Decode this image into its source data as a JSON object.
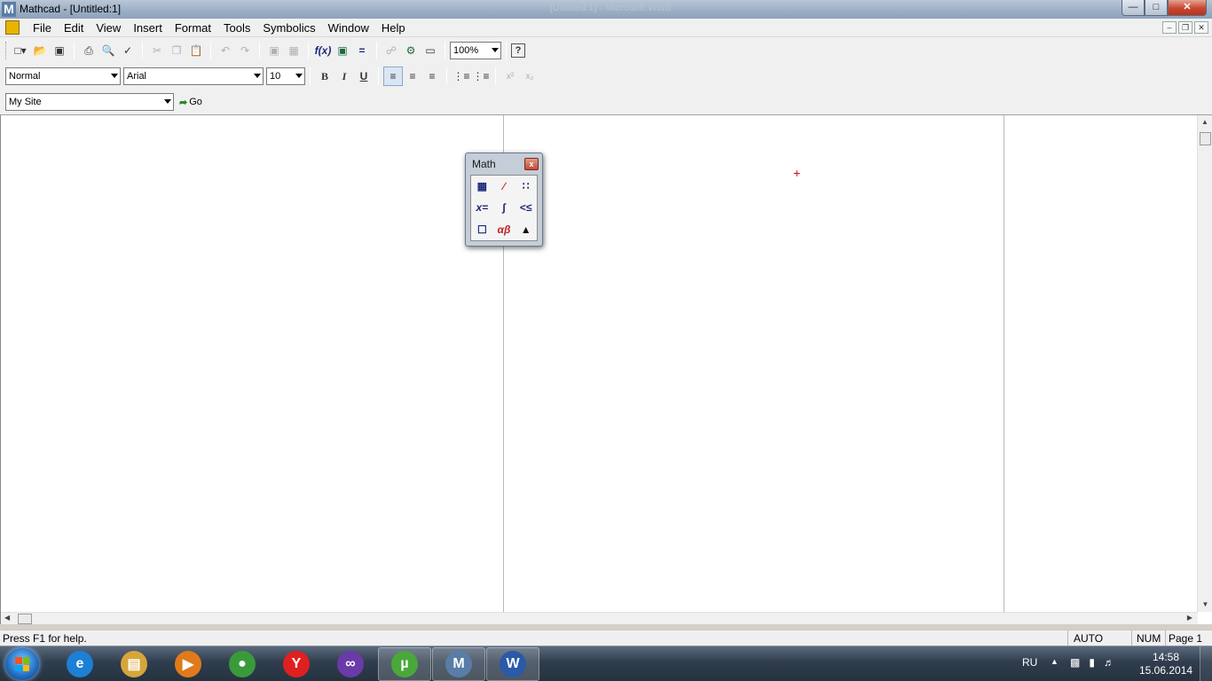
{
  "window": {
    "title": "Mathcad - [Untitled:1]",
    "background_title": "[Untitled:1] - Microsoft Word",
    "app_icon_letter": "M",
    "controls": {
      "minimize": "—",
      "maximize": "□",
      "close": "✕"
    }
  },
  "menubar": {
    "items": [
      "File",
      "Edit",
      "View",
      "Insert",
      "Format",
      "Tools",
      "Symbolics",
      "Window",
      "Help"
    ],
    "mdi_controls": {
      "minimize": "–",
      "restore": "❐",
      "close": "✕"
    }
  },
  "toolbar_standard": {
    "zoom": "100%",
    "help_icon": "?"
  },
  "toolbar_formatting": {
    "style": "Normal",
    "font": "Arial",
    "size": "10",
    "bold": "B",
    "italic": "I",
    "underline": "U",
    "superscript": "x²",
    "subscript": "x₂"
  },
  "toolbar_resources": {
    "site": "My Site",
    "go_label": "Go"
  },
  "math_palette": {
    "title": "Math",
    "close": "x",
    "buttons": [
      "▦",
      "∕",
      "∷",
      "x=",
      "∫",
      "<≤",
      "☐",
      "αβ",
      "▲"
    ]
  },
  "statusbar": {
    "help_text": "Press F1 for help.",
    "mode": "AUTO",
    "num": "NUM",
    "page": "Page 1"
  },
  "taskbar": {
    "language": "RU",
    "time": "14:58",
    "date": "15.06.2014",
    "apps": [
      {
        "name": "internet-explorer",
        "letter": "e",
        "color": "#1d7fd6"
      },
      {
        "name": "file-explorer",
        "letter": "▤",
        "color": "#d6a63a"
      },
      {
        "name": "media-player",
        "letter": "▶",
        "color": "#e07a1a"
      },
      {
        "name": "chrome",
        "letter": "●",
        "color": "#3a9a3a"
      },
      {
        "name": "yandex-browser",
        "letter": "Y",
        "color": "#e02020"
      },
      {
        "name": "visual-studio",
        "letter": "∞",
        "color": "#6a3aa8"
      },
      {
        "name": "utorrent",
        "letter": "µ",
        "color": "#4aa83a"
      },
      {
        "name": "mathcad",
        "letter": "M",
        "color": "#5a7da8"
      },
      {
        "name": "word",
        "letter": "W",
        "color": "#2a5aa8"
      }
    ]
  }
}
